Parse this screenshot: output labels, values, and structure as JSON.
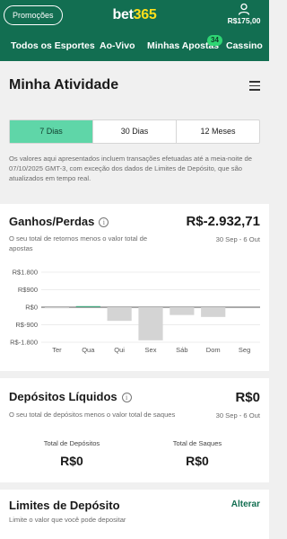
{
  "header": {
    "promo_label": "Promoções",
    "logo_part1": "bet",
    "logo_part2": "365",
    "balance": "R$175,00",
    "account_icon": "user-icon"
  },
  "nav": {
    "items": [
      {
        "label": "Todos os Esportes"
      },
      {
        "label": "Ao-Vivo"
      },
      {
        "label": "Minhas Apostas",
        "badge": "34"
      },
      {
        "label": "Cassino"
      }
    ]
  },
  "page": {
    "title": "Minha Atividade",
    "menu_icon": "hamburger-icon",
    "tabs": [
      {
        "label": "7 Dias",
        "active": true
      },
      {
        "label": "30 Dias",
        "active": false
      },
      {
        "label": "12 Meses",
        "active": false
      }
    ],
    "note": "Os valores aqui apresentados incluem transações efetuadas até a meia-noite de 07/10/2025 GMT-3, com exceção dos dados de Limites de Depósito, que são atualizados em tempo real."
  },
  "gains": {
    "title": "Ganhos/Perdas",
    "value": "R$-2.932,71",
    "subtitle": "O seu total de retornos menos o valor total de apostas",
    "range": "30 Sep - 6 Out"
  },
  "chart_data": {
    "type": "bar",
    "categories": [
      "Ter",
      "Qua",
      "Qui",
      "Sex",
      "Sáb",
      "Dom",
      "Seg"
    ],
    "values": [
      -40,
      30,
      -700,
      -1700,
      -400,
      -500,
      0
    ],
    "ytick_labels": [
      "R$1.800",
      "R$900",
      "R$0",
      "R$-900",
      "R$-1.800"
    ],
    "ylim": [
      -1800,
      1800
    ],
    "colors": {
      "negative": "#d4d4d4",
      "positive": "#3ea37a",
      "zero_line": "#555555",
      "grid": "#e6e6e6"
    }
  },
  "deposits": {
    "title": "Depósitos Líquidos",
    "value": "R$0",
    "subtitle": "O seu total de depósitos menos o valor total de saques",
    "range": "30 Sep - 6 Out",
    "total_deposits_label": "Total de Depósitos",
    "total_deposits_value": "R$0",
    "total_withdrawals_label": "Total de Saques",
    "total_withdrawals_value": "R$0"
  },
  "limits": {
    "title": "Limites de Depósito",
    "action": "Alterar",
    "subtitle": "Limite o valor que você pode depositar"
  },
  "colors": {
    "brand_green": "#126e51",
    "brand_yellow": "#ffdf1b",
    "tab_active": "#5fd6a8"
  }
}
